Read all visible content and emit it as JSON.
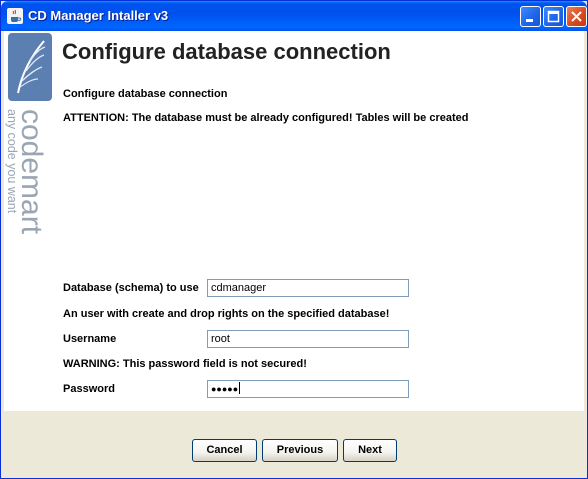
{
  "window": {
    "title": "CD Manager Intaller v3"
  },
  "logo": {
    "brand": "codemart",
    "tagline": "any code you want"
  },
  "page": {
    "title": "Configure database connection",
    "subtitle": "Configure database connection",
    "attention": "ATTENTION: The database must be already configured! Tables will be created"
  },
  "form": {
    "database_label": "Database (schema) to use",
    "database_value": "cdmanager",
    "user_note": "An user with create and drop rights on the specified database!",
    "username_label": "Username",
    "username_value": "root",
    "password_warning": "WARNING: This password field is not secured!",
    "password_label": "Password",
    "password_masked": "●●●●●"
  },
  "buttons": {
    "cancel": "Cancel",
    "previous": "Previous",
    "next": "Next"
  },
  "colors": {
    "titlebar": "#0053ee",
    "logo_blue": "#5b7fb0",
    "logo_text": "#9aa6b3"
  }
}
